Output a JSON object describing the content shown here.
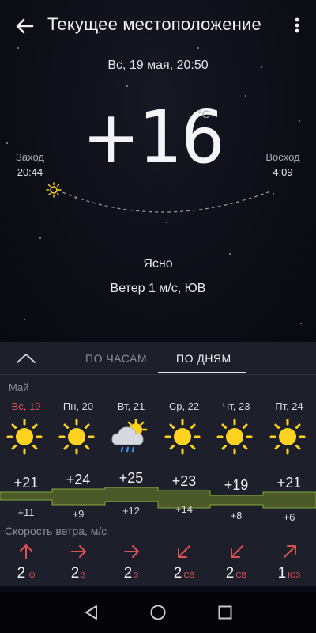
{
  "appbar": {
    "title": "Текущее местоположение"
  },
  "current": {
    "date": "Вс, 19 мая, 20:50",
    "temperature": "+16",
    "unit": "°C",
    "sunset_label": "Заход",
    "sunset_time": "20:44",
    "sunrise_label": "Восход",
    "sunrise_time": "4:09",
    "condition": "Ясно",
    "wind": "Ветер 1 м/с, ЮВ"
  },
  "tabs": [
    {
      "label": "ПО ЧАСАМ",
      "active": false
    },
    {
      "label": "ПО ДНЯМ",
      "active": true
    }
  ],
  "forecast": {
    "month": "Май",
    "wind_title": "Скорость ветра, м/с",
    "days": [
      {
        "label": "Вс, 19",
        "icon": "sun-icon",
        "high": "+21",
        "low": "+11",
        "wind_speed": "2",
        "wind_dir": "Ю",
        "today": true
      },
      {
        "label": "Пн, 20",
        "icon": "sun-icon",
        "high": "+24",
        "low": "+9",
        "wind_speed": "2",
        "wind_dir": "З",
        "today": false
      },
      {
        "label": "Вт, 21",
        "icon": "cloud-rain-sun-icon",
        "high": "+25",
        "low": "+12",
        "wind_speed": "2",
        "wind_dir": "З",
        "today": false
      },
      {
        "label": "Ср, 22",
        "icon": "sun-icon",
        "high": "+23",
        "low": "+14",
        "wind_speed": "2",
        "wind_dir": "СВ",
        "today": false
      },
      {
        "label": "Чт, 23",
        "icon": "sun-icon",
        "high": "+19",
        "low": "+8",
        "wind_speed": "2",
        "wind_dir": "СВ",
        "today": false
      },
      {
        "label": "Пт, 24",
        "icon": "sun-icon",
        "high": "+21",
        "low": "+6",
        "wind_speed": "1",
        "wind_dir": "ЮЗ",
        "today": false
      }
    ]
  },
  "colors": {
    "accent_red": "#e05252",
    "sun_yellow": "#ffd21f",
    "band_green": "#6e8f2e"
  }
}
